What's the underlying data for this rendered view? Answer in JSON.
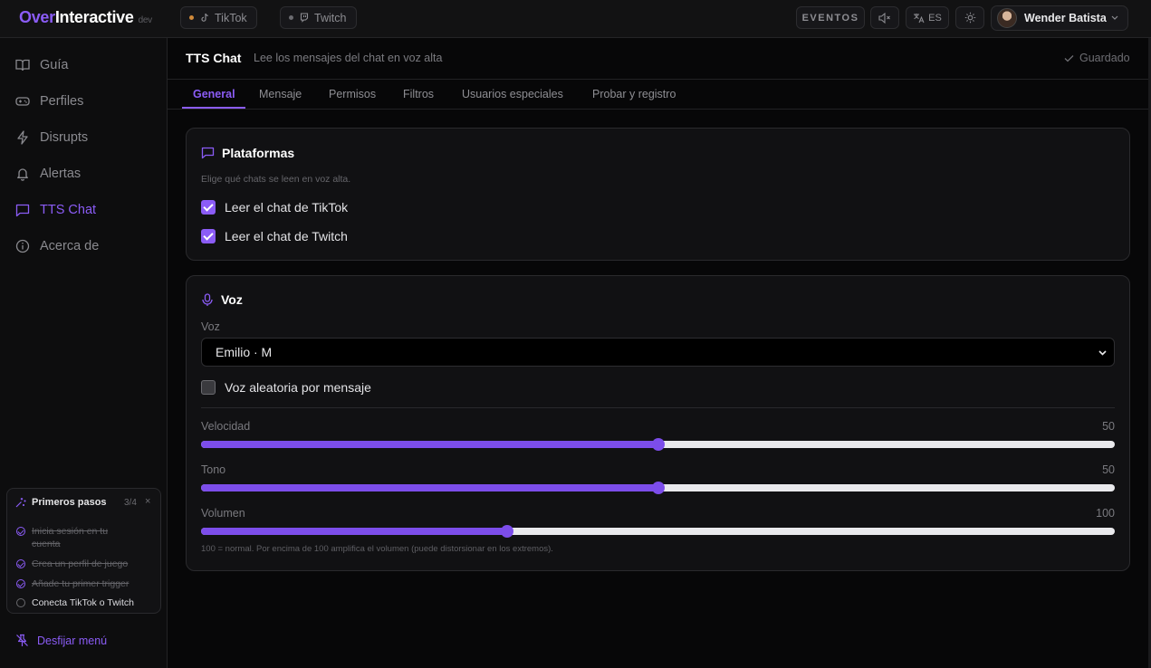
{
  "brand": {
    "part1": "Over",
    "part2": "Interactive",
    "badge": "dev"
  },
  "topbar": {
    "platforms": [
      {
        "label": "TikTok",
        "icon": "tiktok-icon",
        "dot_color": "#d08a3a"
      },
      {
        "label": "Twitch",
        "icon": "twitch-icon",
        "dot_color": "#6b6b70"
      }
    ],
    "events_label": "EVENTOS",
    "language_label": "ES",
    "user_name": "Wender Batista"
  },
  "sidebar": {
    "items": [
      {
        "label": "Guía",
        "icon": "book-icon"
      },
      {
        "label": "Perfiles",
        "icon": "gamepad-icon"
      },
      {
        "label": "Disrupts",
        "icon": "bolt-icon"
      },
      {
        "label": "Alertas",
        "icon": "bell-icon"
      },
      {
        "label": "TTS Chat",
        "icon": "chat-icon",
        "active": true
      },
      {
        "label": "Acerca de",
        "icon": "info-icon"
      }
    ],
    "onboarding": {
      "title": "Primeros pasos",
      "progress": "3/4",
      "close": "×",
      "steps": [
        {
          "label": "Inicia sesión en tu cuenta",
          "done": true
        },
        {
          "label": "Crea un perfil de juego",
          "done": true
        },
        {
          "label": "Añade tu primer trigger",
          "done": true
        },
        {
          "label": "Conecta TikTok o Twitch",
          "done": false
        }
      ]
    },
    "unpin_label": "Desfijar menú"
  },
  "page": {
    "title": "TTS Chat",
    "subtitle": "Lee los mensajes del chat en voz alta",
    "saved_label": "Guardado",
    "tabs": [
      "General",
      "Mensaje",
      "Permisos",
      "Filtros",
      "Usuarios especiales",
      "Probar y registro"
    ],
    "active_tab": "General"
  },
  "platforms_card": {
    "title": "Plataformas",
    "hint": "Elige qué chats se leen en voz alta.",
    "options": [
      {
        "label": "Leer el chat de TikTok",
        "checked": true
      },
      {
        "label": "Leer el chat de Twitch",
        "checked": true
      }
    ]
  },
  "voice_card": {
    "title": "Voz",
    "voice_label": "Voz",
    "voice_value": "Emilio · M",
    "random_label": "Voz aleatoria por mensaje",
    "random_checked": false,
    "sliders": [
      {
        "label": "Velocidad",
        "value": "50",
        "fraction": 0.5
      },
      {
        "label": "Tono",
        "value": "50",
        "fraction": 0.5
      },
      {
        "label": "Volumen",
        "value": "100",
        "fraction": 0.335
      }
    ],
    "note": "100 = normal. Por encima de 100 amplifica el volumen (puede distorsionar en los extremos)."
  },
  "colors": {
    "accent": "#8b5cf6",
    "background": "#070708",
    "card": "#111113"
  }
}
